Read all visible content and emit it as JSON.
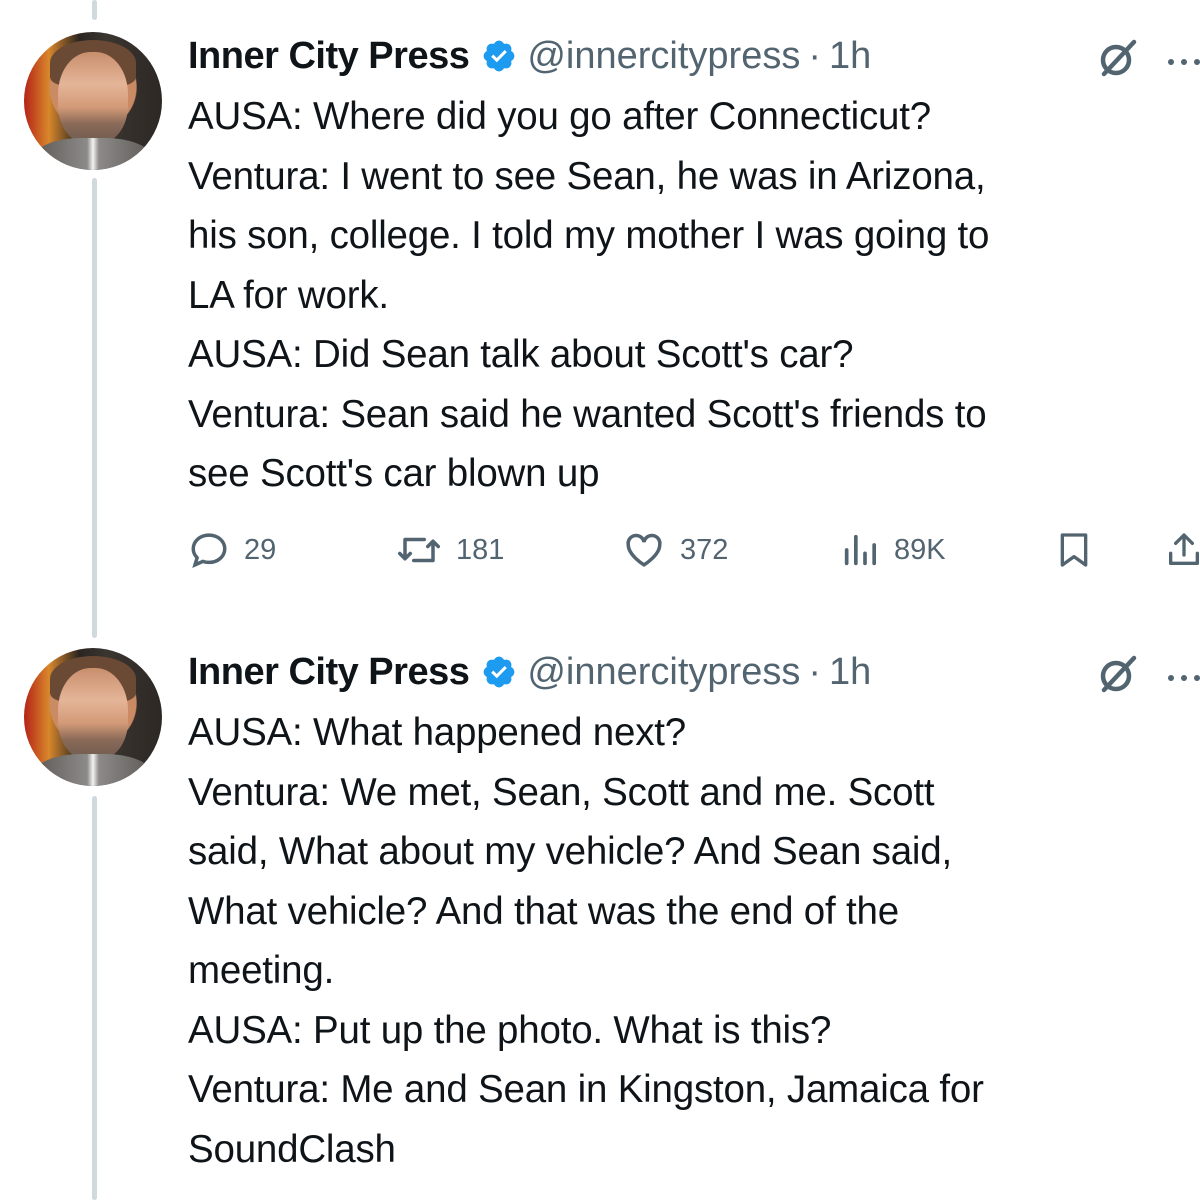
{
  "tweets": [
    {
      "author": "Inner City Press",
      "handle": "@innercitypress",
      "separator": "·",
      "time": "1h",
      "lines": [
        "AUSA: Where did you go after Connecticut?",
        "Ventura: I went to see Sean, he was in Arizona,",
        "his son, college. I told my mother I was going to",
        "LA for work.",
        "AUSA: Did Sean talk about Scott's car?",
        "Ventura: Sean said he wanted Scott's friends to",
        "see Scott's car blown up"
      ],
      "replies": "29",
      "reposts": "181",
      "likes": "372",
      "views": "89K"
    },
    {
      "author": "Inner City Press",
      "handle": "@innercitypress",
      "separator": "·",
      "time": "1h",
      "lines": [
        "AUSA: What happened next?",
        "Ventura: We met, Sean, Scott and me. Scott",
        "said, What about my vehicle? And Sean said,",
        "What vehicle? And that was the end of the",
        "meeting.",
        "AUSA: Put up the photo. What is this?",
        "Ventura: Me and Sean in Kingston, Jamaica for",
        "SoundClash"
      ]
    }
  ],
  "colors": {
    "verified": "#1d9bf0",
    "muted": "#536471",
    "thread_line": "#cfd9de",
    "text": "#0f1419"
  },
  "icons": [
    "reply-icon",
    "repost-icon",
    "like-icon",
    "views-icon",
    "bookmark-icon",
    "share-icon",
    "grok-icon",
    "more-icon",
    "verified-badge-icon"
  ]
}
